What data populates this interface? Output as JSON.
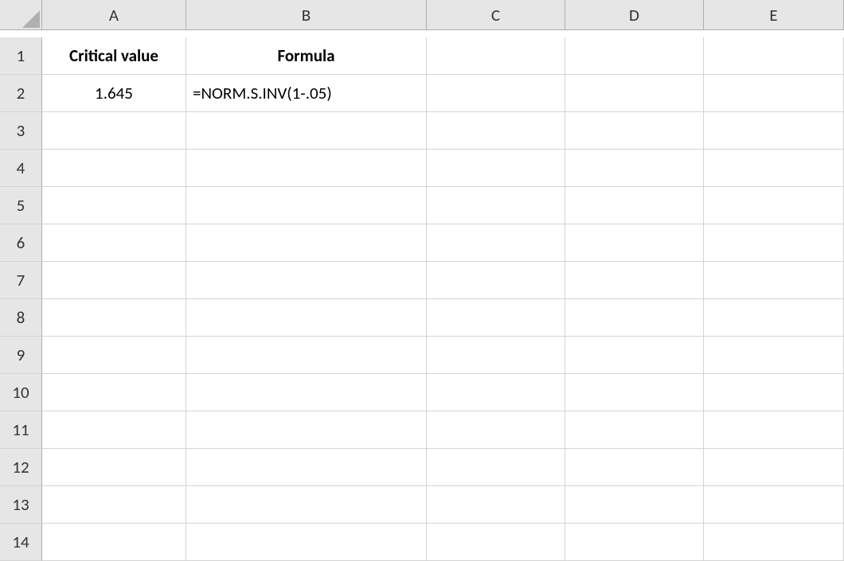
{
  "columns": [
    "A",
    "B",
    "C",
    "D",
    "E"
  ],
  "rows": [
    "1",
    "2",
    "3",
    "4",
    "5",
    "6",
    "7",
    "8",
    "9",
    "10",
    "11",
    "12",
    "13",
    "14"
  ],
  "cells": {
    "A1": "Critical value",
    "B1": "Formula",
    "A2": "1.645",
    "B2": "=NORM.S.INV(1-.05)"
  }
}
